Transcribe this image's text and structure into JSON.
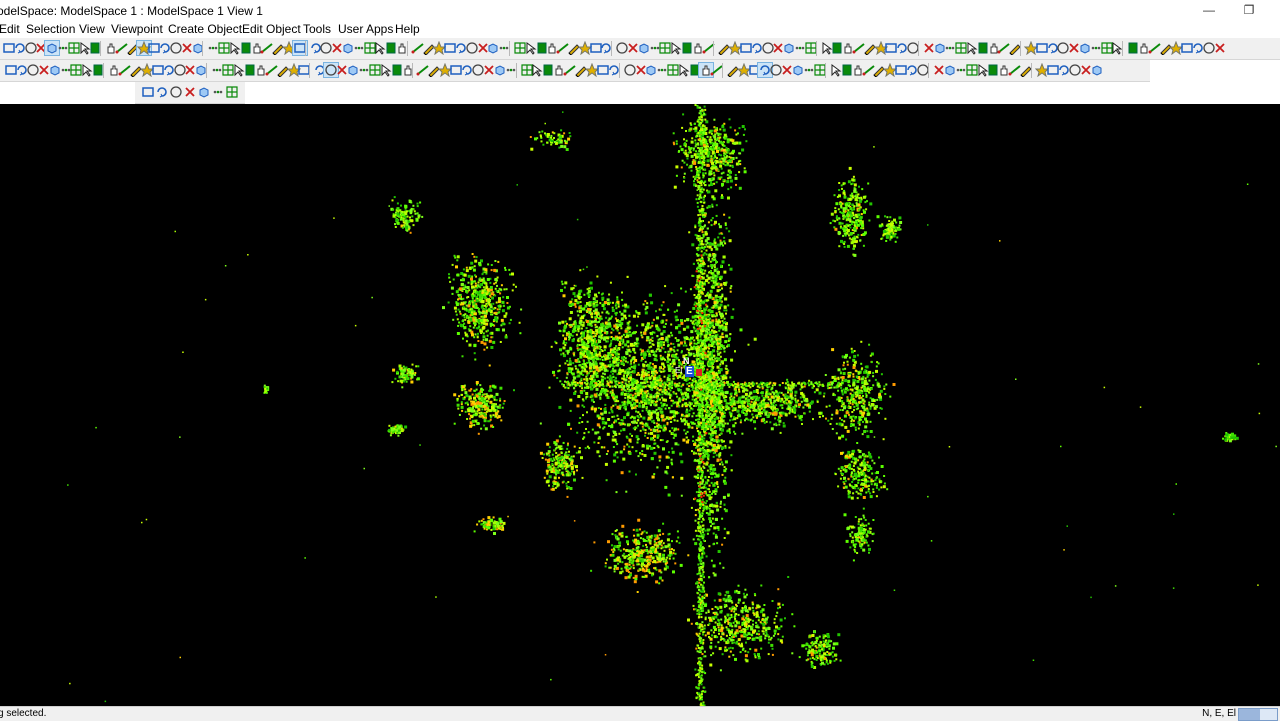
{
  "window": {
    "title": "odelSpace: ModelSpace 1 : ModelSpace 1 View 1",
    "minimize_glyph": "—",
    "restore_glyph": "❐"
  },
  "menu": [
    {
      "label": "Edit"
    },
    {
      "label": "Selection"
    },
    {
      "label": "View"
    },
    {
      "label": "Viewpoint"
    },
    {
      "label": "Create Object"
    },
    {
      "label": "Edit Object"
    },
    {
      "label": "Tools"
    },
    {
      "label": "User Apps"
    },
    {
      "label": "Help"
    }
  ],
  "toolbars": {
    "row1_icon_count": 108,
    "row2_icon_count": 96,
    "row3_icon_count": 7
  },
  "viewport": {
    "background": "#000000",
    "point_colors": [
      "#5cff00",
      "#7dff1a",
      "#3fe000",
      "#a6ff00",
      "#ffd000",
      "#ff9a00",
      "#22c400",
      "#c8ff00"
    ],
    "origin_marker": {
      "north_label": "N",
      "east_label": "E",
      "elev_label": "El"
    }
  },
  "status": {
    "message": "g selected.",
    "coords_label": "N, E, El",
    "progress_fraction": 0.55
  },
  "colors": {
    "accent": "#2a6fd6",
    "icon_green": "#0a8a0a",
    "icon_blue": "#1d5fbf",
    "icon_red": "#c81e1e",
    "icon_yellow": "#e0b000"
  }
}
